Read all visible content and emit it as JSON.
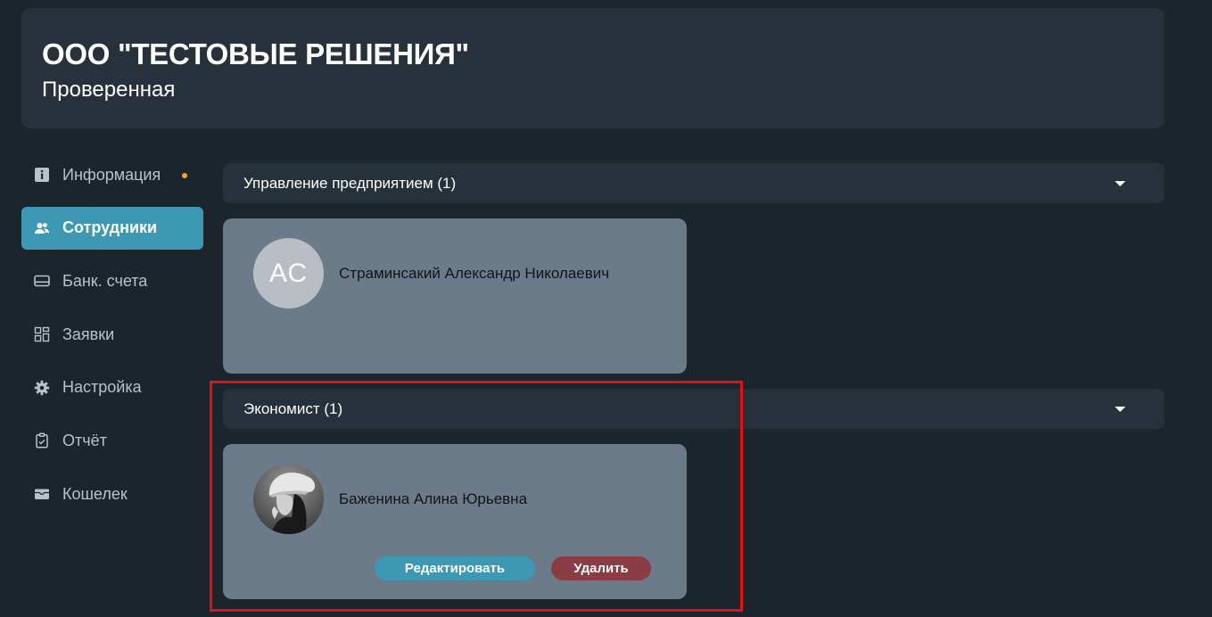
{
  "header": {
    "company_name": "ООО \"ТЕСТОВЫЕ РЕШЕНИЯ\"",
    "status": "Проверенная"
  },
  "sidebar": {
    "items": [
      {
        "label": "Информация",
        "icon": "info-icon",
        "has_dot": true
      },
      {
        "label": "Сотрудники",
        "icon": "users-icon",
        "active": true
      },
      {
        "label": "Банк. счета",
        "icon": "card-icon"
      },
      {
        "label": "Заявки",
        "icon": "grid-icon"
      },
      {
        "label": "Настройка",
        "icon": "gear-icon"
      },
      {
        "label": "Отчёт",
        "icon": "clipboard-icon"
      },
      {
        "label": "Кошелек",
        "icon": "wallet-icon"
      }
    ]
  },
  "sections": [
    {
      "title": "Управление предприятием (1)",
      "employee": {
        "name": "Страминсакий Александр Николаевич",
        "initials": "АС"
      }
    },
    {
      "title": "Экономист (1)",
      "employee": {
        "name": "Баженина Алина Юрьевна",
        "has_photo": true
      },
      "actions": {
        "edit": "Редактировать",
        "delete": "Удалить"
      }
    }
  ],
  "colors": {
    "background": "#1c242c",
    "panel": "#27313b",
    "accent": "#3d98b4",
    "card": "#6b7b89",
    "danger": "#8c3c45",
    "notification_dot": "#f5a623",
    "highlight": "#e30f14"
  }
}
